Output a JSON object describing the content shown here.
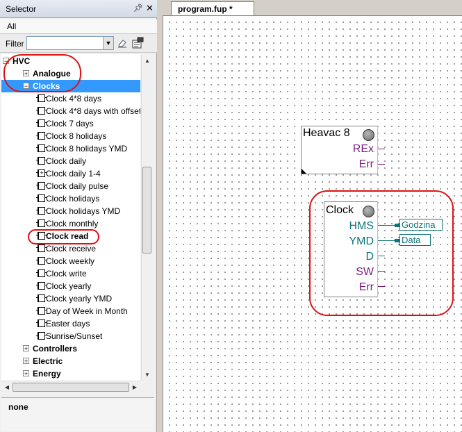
{
  "selector": {
    "title": "Selector",
    "tab_all": "All",
    "filter_label": "Filter",
    "filter_value": "",
    "tree": {
      "root": "HVC",
      "analogue": "Analogue",
      "clocks": "Clocks",
      "clock_items": [
        "Clock 4*8 days",
        "Clock 4*8 days with offset",
        "Clock 7 days",
        "Clock 8 holidays",
        "Clock 8 holidays YMD",
        "Clock daily",
        "Clock daily 1-4",
        "Clock daily pulse",
        "Clock holidays",
        "Clock holidays YMD",
        "Clock monthly",
        "Clock read",
        "Clock receive",
        "Clock weekly",
        "Clock write",
        "Clock yearly",
        "Clock yearly YMD",
        "Day of Week in Month",
        "Easter days",
        "Sunrise/Sunset"
      ],
      "groups_after": [
        "Controllers",
        "Electric",
        "Energy"
      ]
    },
    "info_text": "none"
  },
  "editor": {
    "tab_label": "program.fup *",
    "blocks": {
      "heavac": {
        "title": "Heavac 8",
        "outputs": [
          "REx",
          "Err"
        ]
      },
      "clock": {
        "title": "Clock",
        "outputs": [
          "HMS",
          "YMD",
          "D",
          "SW",
          "Err"
        ],
        "tags": [
          "Godzina",
          "Data"
        ]
      }
    }
  },
  "colors": {
    "highlight_oval": "#e01010",
    "selected_row": "#3399ff",
    "pin_purple": "#7a1d7e",
    "pin_teal": "#0d7478"
  }
}
